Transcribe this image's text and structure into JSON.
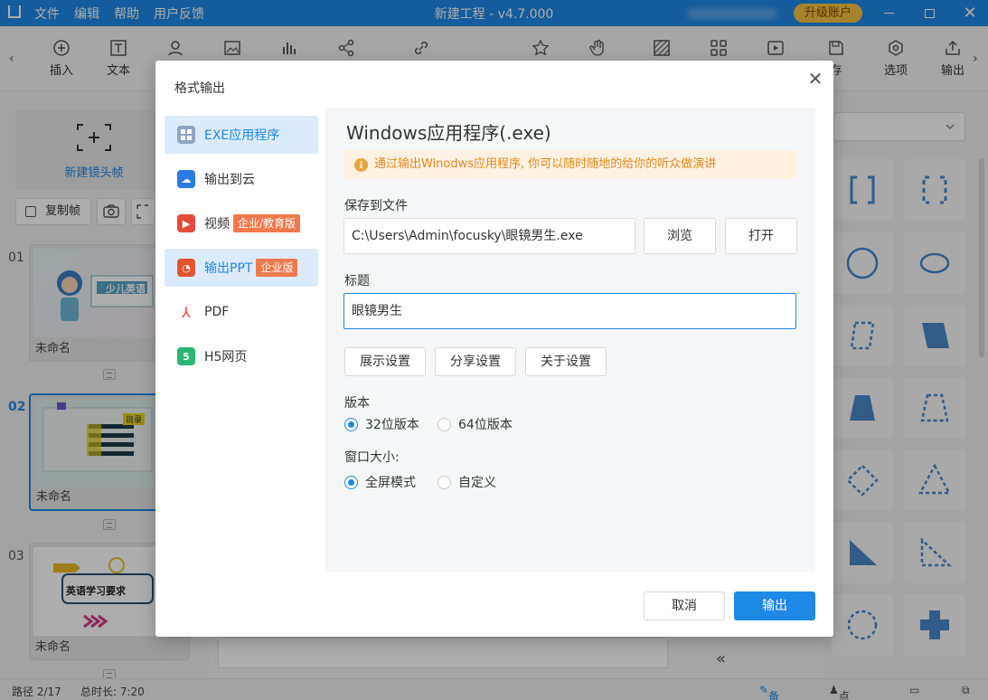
{
  "titlebar": {
    "menu": [
      "文件",
      "编辑",
      "帮助",
      "用户反馈"
    ],
    "title": "新建工程 - v4.7.000",
    "upgrade": "升级账户"
  },
  "toolbar": {
    "items": [
      {
        "label": "插入",
        "icon": "plus-circle-icon"
      },
      {
        "label": "文本",
        "icon": "text-icon"
      },
      {
        "label": "",
        "icon": "person-icon"
      },
      {
        "label": "",
        "icon": "image-icon"
      },
      {
        "label": "",
        "icon": "chart-icon"
      },
      {
        "label": "",
        "icon": "share-icon"
      },
      {
        "label": "",
        "icon": "link-icon"
      },
      {
        "label": "",
        "icon": "star-icon"
      },
      {
        "label": "",
        "icon": "hand-icon"
      },
      {
        "label": "",
        "icon": "pattern-icon"
      },
      {
        "label": "",
        "icon": "grid-icon"
      },
      {
        "label": "",
        "icon": "play-icon"
      },
      {
        "label": "存",
        "icon": "save-icon"
      },
      {
        "label": "选项",
        "icon": "settings-icon"
      },
      {
        "label": "输出",
        "icon": "export-icon"
      }
    ]
  },
  "left": {
    "new_frame": "新建镜头帧",
    "copy_frame": "复制帧",
    "slides": [
      {
        "num": "01",
        "name": "未命名",
        "thumb_text": "少儿英语"
      },
      {
        "num": "02",
        "name": "未命名",
        "thumb_text": "目录"
      },
      {
        "num": "03",
        "name": "未命名",
        "thumb_text": "英语学习要求"
      }
    ]
  },
  "status": {
    "path": "路径 2/17",
    "duration": "总时长: 7:20",
    "notes": "备注",
    "rollcall": "点名"
  },
  "dialog": {
    "title": "格式输出",
    "nav": [
      {
        "label": "EXE应用程序",
        "tag": "",
        "color": "#8ea6c8"
      },
      {
        "label": "输出到云",
        "tag": "",
        "color": "#2b7be0"
      },
      {
        "label": "视频",
        "tag": "企业/教育版",
        "color": "#e54a3b"
      },
      {
        "label": "输出PPT",
        "tag": "企业版",
        "color": "#e2542f"
      },
      {
        "label": "PDF",
        "tag": "",
        "color": "#e8463a"
      },
      {
        "label": "H5网页",
        "tag": "",
        "color": "#2bb673"
      }
    ],
    "heading": "Windows应用程序(.exe)",
    "notice": "通过输出Winodws应用程序, 你可以随时随地的给你的听众做演讲",
    "save_label": "保存到文件",
    "save_path": "C:\\Users\\Admin\\focusky\\眼镜男生.exe",
    "browse": "浏览",
    "open": "打开",
    "title_label": "标题",
    "title_value": "眼镜男生",
    "settings": [
      "展示设置",
      "分享设置",
      "关于设置"
    ],
    "version_label": "版本",
    "version_options": [
      "32位版本",
      "64位版本"
    ],
    "version_selected": 0,
    "window_label": "窗口大小:",
    "window_options": [
      "全屏模式",
      "自定义"
    ],
    "window_selected": 0,
    "cancel": "取消",
    "export": "输出"
  }
}
